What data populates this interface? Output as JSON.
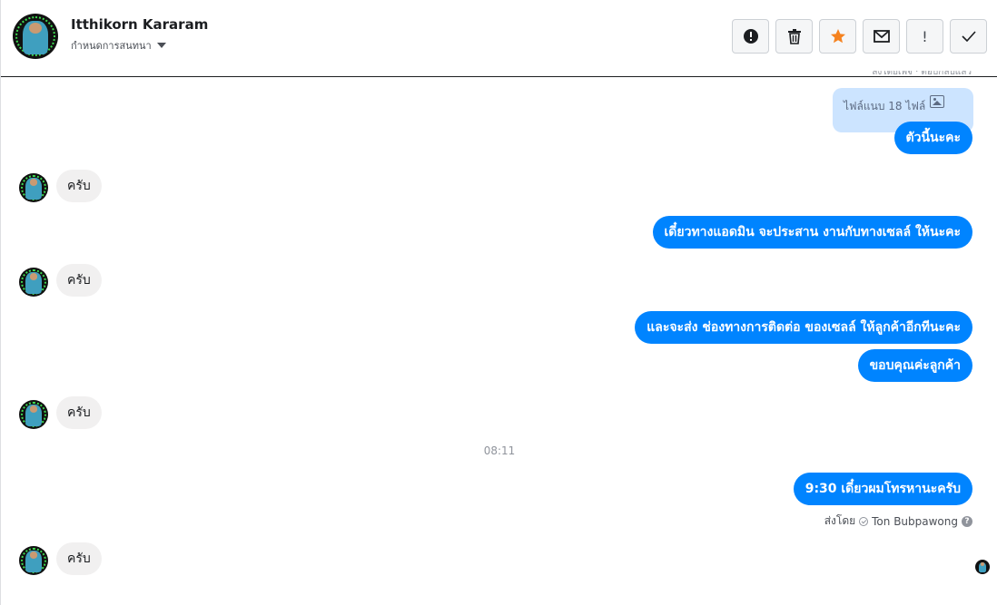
{
  "header": {
    "contact_name": "Itthikorn Kararam",
    "subtitle": "กำหนดการสนทนา"
  },
  "toolbar": [
    {
      "name": "report-button",
      "icon": "alert-circle-icon"
    },
    {
      "name": "delete-button",
      "icon": "trash-icon"
    },
    {
      "name": "star-button",
      "icon": "star-icon",
      "color": "#f5821f"
    },
    {
      "name": "mail-button",
      "icon": "mail-icon"
    },
    {
      "name": "important-button",
      "icon": "exclamation-icon",
      "glyph": "!"
    },
    {
      "name": "done-button",
      "icon": "checkmark-icon"
    }
  ],
  "messages": {
    "cutoff_note": "ส่งโดยเพจ · ตอบกลับแล้ว",
    "file_label": "ไฟล์แนบ 18 ไฟล์",
    "out_1": "ตัวนี้นะคะ",
    "in_1": "ครับ",
    "out_2": "เดี๋ยวทางแอดมิน จะประสาน งานกับทางเซลล์ ให้นะคะ",
    "in_2": "ครับ",
    "out_3": "และจะส่ง ช่องทางการติดต่อ ของเซลล์ ให้ลูกค้าอีกทีนะคะ",
    "out_4": "ขอบคุณค่ะลูกค้า",
    "in_3": "ครับ",
    "time": "08:11",
    "out_5": "9:30 เดี๋ยวผมโทรหานะครับ",
    "sent_by_prefix": "ส่งโดย",
    "sent_by_name": "Ton Bubpawong",
    "in_4": "ครับ"
  },
  "colors": {
    "outgoing": "#0084ff",
    "incoming": "#f1f0f0",
    "file_card": "#cce4ff"
  }
}
